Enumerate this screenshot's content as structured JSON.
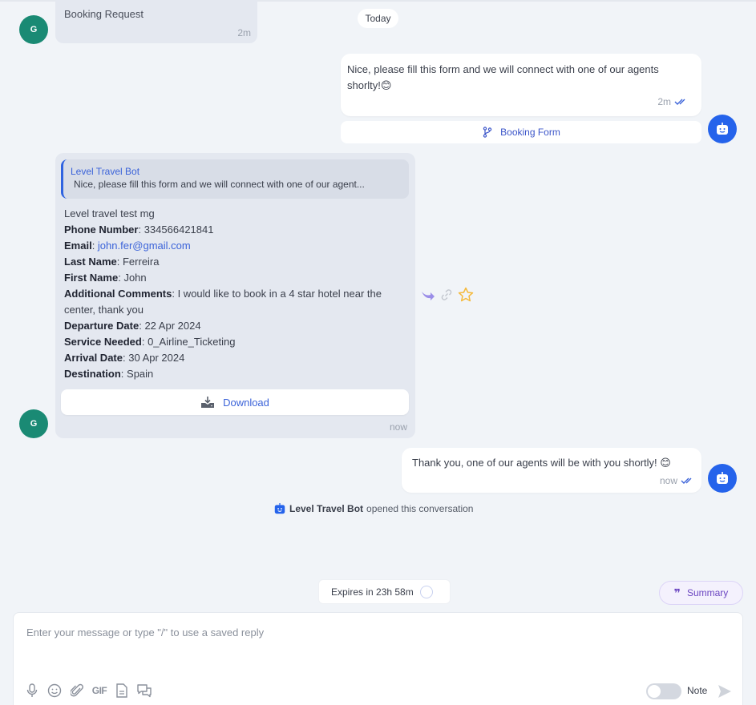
{
  "date_divider": "Today",
  "messages": {
    "m1": {
      "sender_initial": "G",
      "text": "Booking Request",
      "time": "2m"
    },
    "m2": {
      "text": "Nice, please fill this form and we will connect with one of our agents shorlty!",
      "emoji": "😊",
      "time": "2m",
      "button_label": "Booking Form"
    },
    "m3": {
      "sender_initial": "G",
      "quote_author": "Level Travel Bot",
      "quote_text": "Nice, please fill this form and we will connect with one of our agent...",
      "title": "Level travel test mg",
      "fields": [
        {
          "label": "Phone Number",
          "value": "334566421841"
        },
        {
          "label": "Email",
          "value": "john.fer@gmail.com"
        },
        {
          "label": "Last Name",
          "value": "Ferreira"
        },
        {
          "label": "First Name",
          "value": "John"
        },
        {
          "label": "Additional Comments",
          "value": "I would like to book in a 4 star hotel near the center, thank you"
        },
        {
          "label": "Departure Date",
          "value": "22 Apr 2024"
        },
        {
          "label": "Service Needed",
          "value": "0_Airline_Ticketing"
        },
        {
          "label": "Arrival Date",
          "value": "30 Apr 2024"
        },
        {
          "label": "Destination",
          "value": "Spain"
        }
      ],
      "download_label": "Download",
      "time": "now"
    },
    "m4": {
      "text": "Thank you, one of our agents will be with you shortly!",
      "emoji": "😊",
      "time": "now"
    }
  },
  "activity": {
    "actor": "Level Travel Bot",
    "action": "opened this conversation"
  },
  "expires": "Expires in 23h 58m",
  "summary_label": "Summary",
  "composer": {
    "placeholder": "Enter your message or type \"/\" to use a saved reply",
    "value": "",
    "gif_label": "GIF",
    "note_label": "Note",
    "note_enabled": false
  },
  "colors": {
    "accent": "#2563eb",
    "avatar": "#1a8a74",
    "link": "#3b63d9",
    "summary": "#6b46c1",
    "star": "#f5b93a"
  }
}
